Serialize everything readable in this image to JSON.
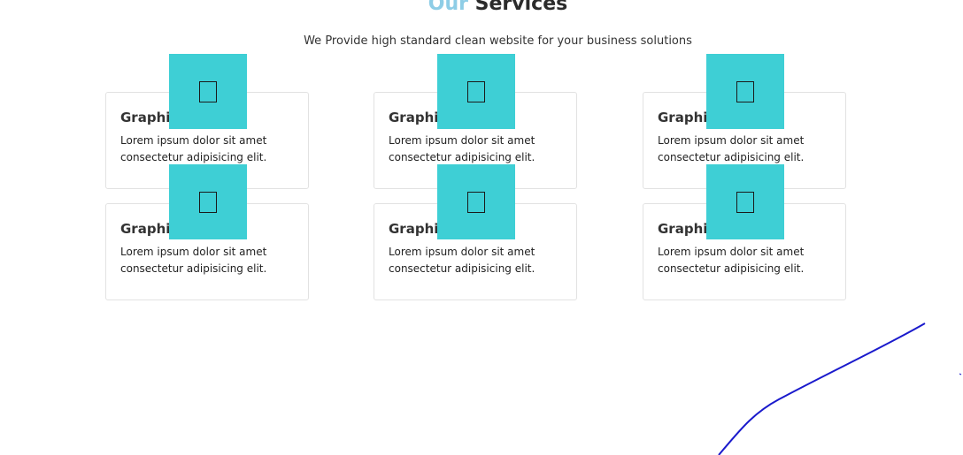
{
  "header": {
    "title_accent": "Our",
    "title_main": "Services",
    "subtitle": "We Provide high standard clean website for your business solutions"
  },
  "services": [
    {
      "title": "Graphic",
      "line1": "Lorem ipsum dolor sit amet",
      "line2": "consectetur adipisicing elit.",
      "icon": "missing-glyph-icon"
    },
    {
      "title": "Graphic",
      "line1": "Lorem ipsum dolor sit amet",
      "line2": "consectetur adipisicing elit.",
      "icon": "missing-glyph-icon"
    },
    {
      "title": "Graphic",
      "line1": "Lorem ipsum dolor sit amet",
      "line2": "consectetur adipisicing elit.",
      "icon": "missing-glyph-icon"
    },
    {
      "title": "Graphic",
      "line1": "Lorem ipsum dolor sit amet",
      "line2": "consectetur adipisicing elit.",
      "icon": "missing-glyph-icon"
    },
    {
      "title": "Graphic",
      "line1": "Lorem ipsum dolor sit amet",
      "line2": "consectetur adipisicing elit.",
      "icon": "missing-glyph-icon"
    },
    {
      "title": "Graphic",
      "line1": "Lorem ipsum dolor sit amet",
      "line2": "consectetur adipisicing elit.",
      "icon": "missing-glyph-icon"
    }
  ],
  "colors": {
    "accent": "#8ecde6",
    "icon_bg": "#3ecfd5",
    "curve": "#1a1acc"
  }
}
